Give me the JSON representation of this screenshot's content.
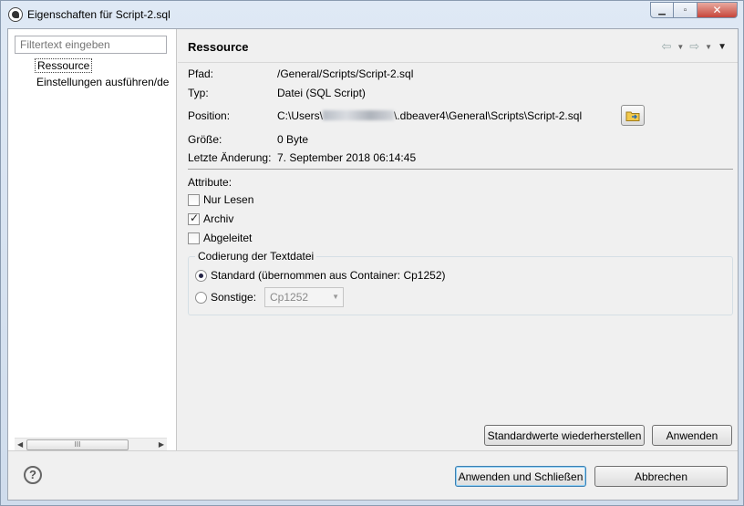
{
  "window": {
    "title": "Eigenschaften für Script-2.sql"
  },
  "sidebar": {
    "filter_placeholder": "Filtertext eingeben",
    "items": [
      {
        "label": "Ressource",
        "selected": true
      },
      {
        "label": "Einstellungen ausführen/de",
        "selected": false
      }
    ],
    "scroll_thumb": "III"
  },
  "page": {
    "title": "Ressource",
    "fields": {
      "path_label": "Pfad:",
      "path_value": "/General/Scripts/Script-2.sql",
      "type_label": "Typ:",
      "type_value": "Datei (SQL Script)",
      "location_label": "Position:",
      "location_prefix": "C:\\Users\\",
      "location_suffix": "\\.dbeaver4\\General\\Scripts\\Script-2.sql",
      "size_label": "Größe:",
      "size_value": "0 Byte",
      "modified_label": "Letzte Änderung:",
      "modified_value": "7. September 2018 06:14:45"
    },
    "attributes": {
      "heading": "Attribute:",
      "read_only": {
        "label": "Nur Lesen",
        "checked": false
      },
      "archive": {
        "label": "Archiv",
        "checked": true
      },
      "derived": {
        "label": "Abgeleitet",
        "checked": false
      }
    },
    "encoding": {
      "group_title": "Codierung der Textdatei",
      "default_label": "Standard (übernommen aus Container: Cp1252)",
      "other_label": "Sonstige:",
      "other_value": "Cp1252",
      "selected": "default"
    },
    "restore_defaults": "Standardwerte wiederherstellen",
    "apply": "Anwenden"
  },
  "footer": {
    "help": "?",
    "apply_close": "Anwenden und Schließen",
    "cancel": "Abbrechen"
  }
}
